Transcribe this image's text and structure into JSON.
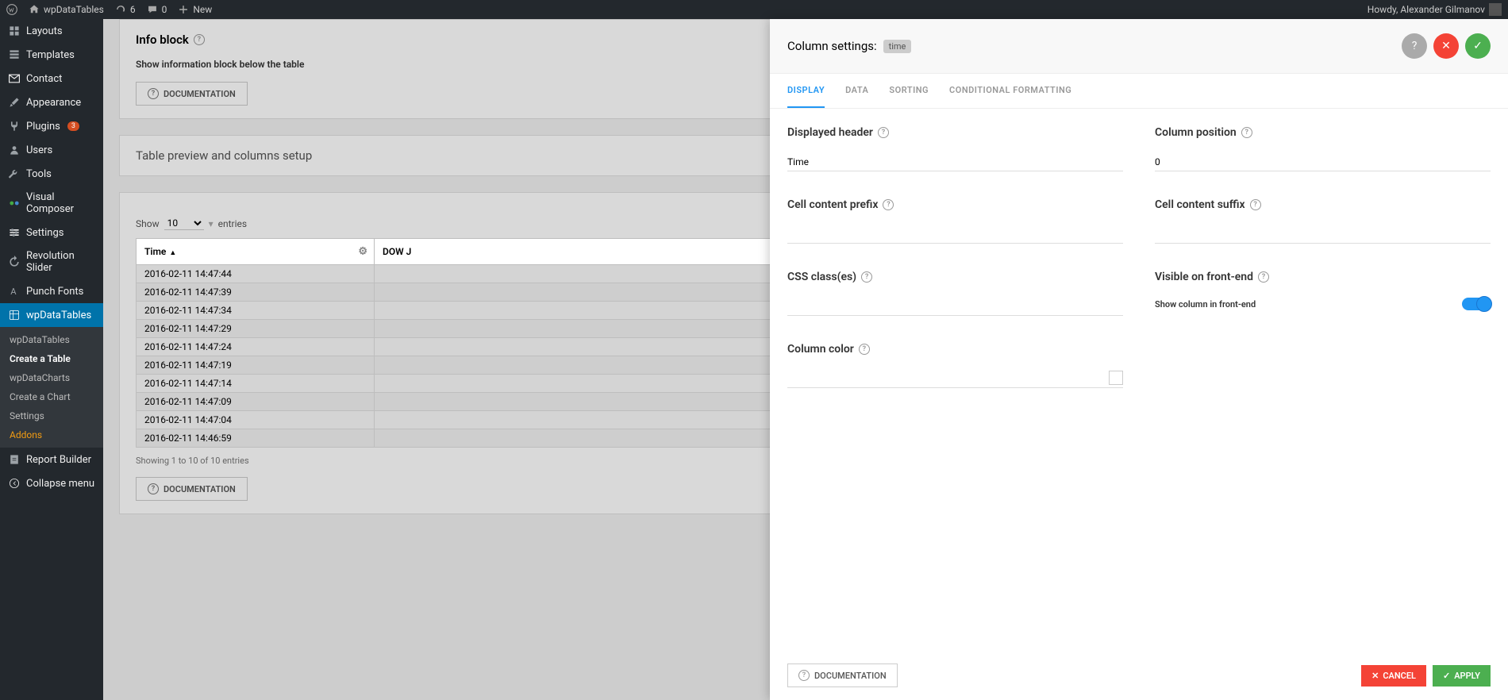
{
  "admin_bar": {
    "site_name": "wpDataTables",
    "updates_count": "6",
    "comments_count": "0",
    "new_label": "New",
    "howdy": "Howdy, Alexander Gilmanov"
  },
  "sidebar": {
    "items": [
      {
        "label": "Layouts",
        "icon": "layouts"
      },
      {
        "label": "Templates",
        "icon": "templates"
      },
      {
        "label": "Contact",
        "icon": "mail"
      },
      {
        "label": "Appearance",
        "icon": "brush"
      },
      {
        "label": "Plugins",
        "icon": "plug",
        "badge": "3"
      },
      {
        "label": "Users",
        "icon": "user"
      },
      {
        "label": "Tools",
        "icon": "wrench"
      },
      {
        "label": "Visual Composer",
        "icon": "vc"
      },
      {
        "label": "Settings",
        "icon": "sliders"
      },
      {
        "label": "Revolution Slider",
        "icon": "rev"
      },
      {
        "label": "Punch Fonts",
        "icon": "font"
      },
      {
        "label": "wpDataTables",
        "icon": "wpdt",
        "active": true
      },
      {
        "label": "Report Builder",
        "icon": "report"
      },
      {
        "label": "Collapse menu",
        "icon": "collapse"
      }
    ],
    "submenu": [
      {
        "label": "wpDataTables"
      },
      {
        "label": "Create a Table",
        "current": true
      },
      {
        "label": "wpDataCharts"
      },
      {
        "label": "Create a Chart"
      },
      {
        "label": "Settings"
      },
      {
        "label": "Addons",
        "addons": true
      }
    ]
  },
  "info_block": {
    "title": "Info block",
    "desc": "Show information block below the table",
    "doc_btn": "DOCUMENTATION"
  },
  "preview": {
    "title": "Table preview and columns setup",
    "show_label": "Show",
    "entries_value": "10",
    "entries_label": "entries",
    "columns": [
      "Time",
      "DOW J"
    ],
    "rows": [
      "2016-02-11 14:47:44",
      "2016-02-11 14:47:39",
      "2016-02-11 14:47:34",
      "2016-02-11 14:47:29",
      "2016-02-11 14:47:24",
      "2016-02-11 14:47:19",
      "2016-02-11 14:47:14",
      "2016-02-11 14:47:09",
      "2016-02-11 14:47:04",
      "2016-02-11 14:46:59"
    ],
    "showing": "Showing 1 to 10 of 10 entries",
    "doc_btn": "DOCUMENTATION"
  },
  "panel": {
    "title_prefix": "Column settings:",
    "column_tag": "time",
    "tabs": [
      "DISPLAY",
      "DATA",
      "SORTING",
      "CONDITIONAL FORMATTING"
    ],
    "fields": {
      "displayed_header": "Displayed header",
      "displayed_header_value": "Time",
      "column_position": "Column position",
      "column_position_value": "0",
      "cell_prefix": "Cell content prefix",
      "cell_suffix": "Cell content suffix",
      "css_classes": "CSS class(es)",
      "visible": "Visible on front-end",
      "visible_desc": "Show column in front-end",
      "column_color": "Column color"
    },
    "doc_btn": "DOCUMENTATION",
    "cancel": "CANCEL",
    "apply": "APPLY"
  }
}
